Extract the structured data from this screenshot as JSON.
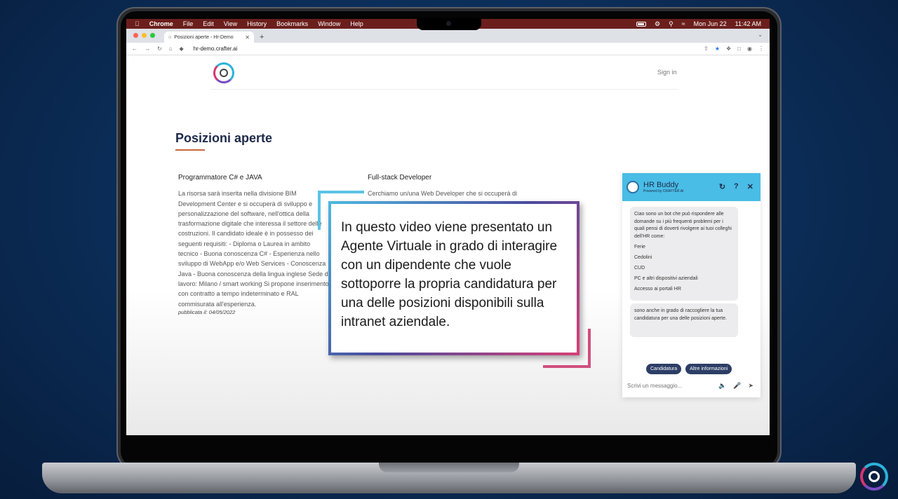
{
  "menubar": {
    "app": "Chrome",
    "items": [
      "File",
      "Edit",
      "View",
      "History",
      "Bookmarks",
      "Window",
      "Help"
    ],
    "date": "Mon Jun 22",
    "time": "11:42 AM"
  },
  "browser": {
    "tab_title": "Posizioni aperte - Hr-Demo",
    "url": "hr-demo.crafter.ai"
  },
  "site": {
    "signin": "Sign in",
    "page_title": "Posizioni aperte"
  },
  "jobs": [
    {
      "title": "Programmatore C# e JAVA",
      "description": "La risorsa sarà inserita nella divisione BIM Development Center e si occuperà di sviluppo e personalizzazione del software, nell'ottica della trasformazione digitale che interessa il settore delle costruzioni. Il candidato ideale è in possesso dei seguenti requisiti: - Diploma o Laurea in ambito tecnico - Buona conoscenza C# - Esperienza nello sviluppo di WebApp e/o Web Services - Conoscenza Java - Buona conoscenza della lingua inglese Sede di lavoro: Milano / smart working Si propone inserimento con contratto a tempo indeterminato e RAL commisurata all'esperienza.",
      "published": "pubblicata il: 04/05/2022"
    },
    {
      "title": "Full-stack Developer",
      "description": "Cerchiamo un/una Web Developer che si occuperà di"
    }
  ],
  "overlay": {
    "caption": "In questo video viene presentato un Agente Virtuale in grado di interagire con un dipendente che vuole sottoporre la propria candidatura per una delle posizioni disponibili sulla intranet aziendale."
  },
  "chat": {
    "name": "HR Buddy",
    "powered_by": "Powered by CRAFTER.AI",
    "message1_intro": "Ciao sono un bot che può rispondere alle domande su i più frequenti problemi per i quali pensi di doverti rivolgere ai tuoi colleghi dell'HR come:",
    "message1_items": [
      "Ferie",
      "Cedolini",
      "CUD",
      "PC e altri dispositivi aziendali",
      "Accesso ai portali HR"
    ],
    "message2": "sono anche in grado di raccogliere la tua candidatura per una delle posizioni aperte.",
    "quick_replies": [
      "Candidatura",
      "Altre informazioni"
    ],
    "input_placeholder": "Scrivi un messaggio..."
  },
  "icons": {
    "apple": "apple-icon",
    "refresh": "refresh-icon",
    "help": "help-icon",
    "close": "close-icon",
    "mute": "mute-icon",
    "mic_off": "mic-off-icon",
    "send": "send-icon"
  },
  "colors": {
    "chat_header": "#49bde6",
    "close_fab": "#d8336e",
    "title_accent": "#c8673a",
    "quick_reply": "#2c3e66"
  }
}
